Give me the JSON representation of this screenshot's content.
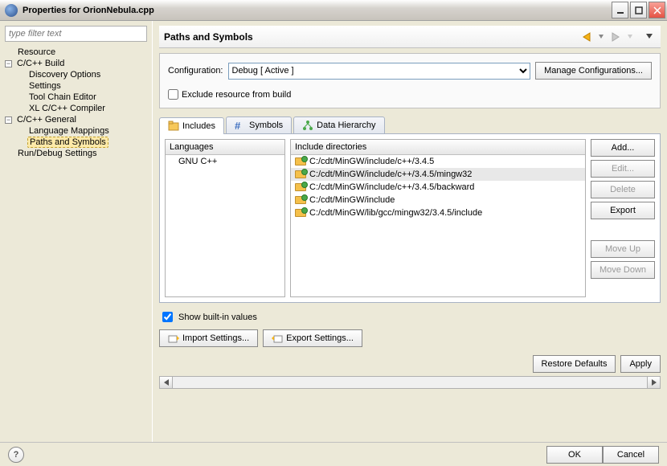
{
  "window": {
    "title": "Properties for OrionNebula.cpp"
  },
  "filter": {
    "placeholder": "type filter text"
  },
  "tree": {
    "resource": "Resource",
    "build": "C/C++ Build",
    "build_discovery": "Discovery Options",
    "build_settings": "Settings",
    "build_toolchain": "Tool Chain Editor",
    "build_xl": "XL C/C++ Compiler",
    "general": "C/C++ General",
    "gen_lang": "Language Mappings",
    "gen_paths": "Paths and Symbols",
    "rundebug": "Run/Debug Settings"
  },
  "page": {
    "heading": "Paths and Symbols",
    "config_label": "Configuration:",
    "config_value": "Debug  [ Active ]",
    "manage": "Manage Configurations...",
    "exclude": "Exclude resource from build"
  },
  "tabs": {
    "includes": "Includes",
    "symbols": "Symbols",
    "datahier": "Data Hierarchy"
  },
  "langs": {
    "header": "Languages",
    "items": [
      "GNU C++"
    ]
  },
  "dirs": {
    "header": "Include directories",
    "items": [
      "C:/cdt/MinGW/include/c++/3.4.5",
      "C:/cdt/MinGW/include/c++/3.4.5/mingw32",
      "C:/cdt/MinGW/include/c++/3.4.5/backward",
      "C:/cdt/MinGW/include",
      "C:/cdt/MinGW/lib/gcc/mingw32/3.4.5/include"
    ],
    "selected": 1
  },
  "actions": {
    "add": "Add...",
    "edit": "Edit...",
    "delete": "Delete",
    "export": "Export",
    "moveup": "Move Up",
    "movedown": "Move Down"
  },
  "builtin": "Show built-in values",
  "import": "Import Settings...",
  "exportset": "Export Settings...",
  "restore": "Restore Defaults",
  "apply": "Apply",
  "ok": "OK",
  "cancel": "Cancel"
}
